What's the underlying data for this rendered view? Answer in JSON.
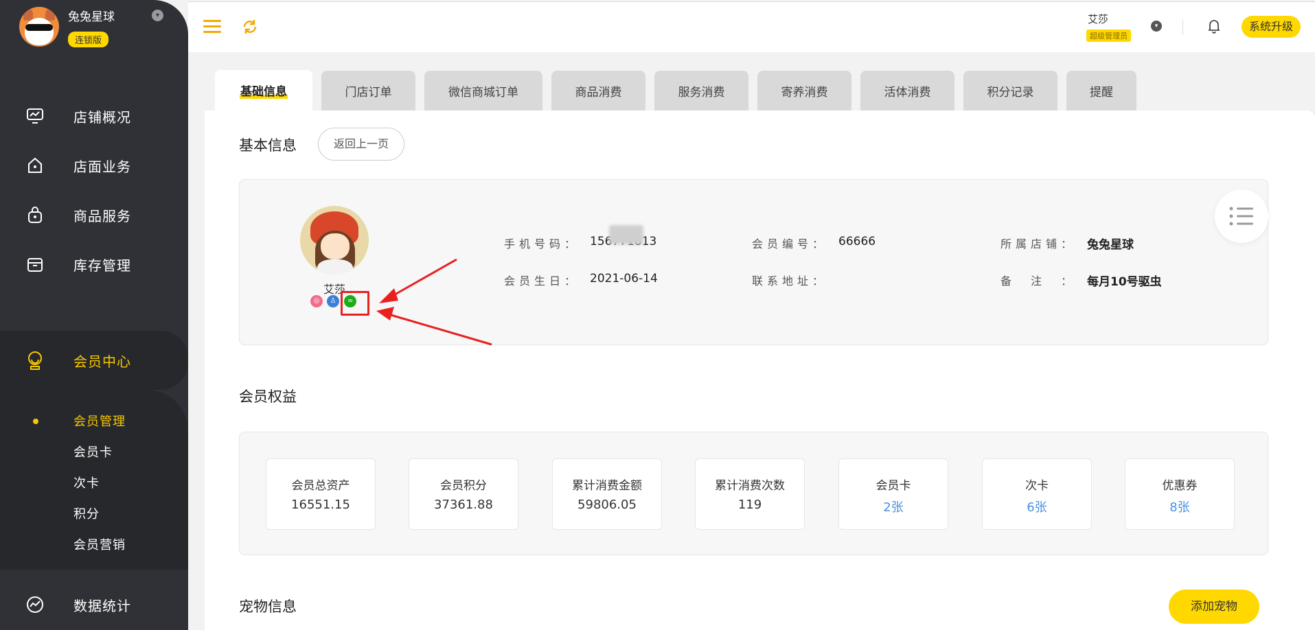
{
  "sidebar": {
    "brand_name": "兔兔星球",
    "brand_badge": "连锁版",
    "items": [
      {
        "label": "店铺概况",
        "icon": "monitor-icon"
      },
      {
        "label": "店面业务",
        "icon": "house-icon"
      },
      {
        "label": "商品服务",
        "icon": "bag-icon"
      },
      {
        "label": "库存管理",
        "icon": "box-icon"
      },
      {
        "label": "会员中心",
        "icon": "member-icon",
        "active": true
      },
      {
        "label": "数据统计",
        "icon": "chart-icon"
      }
    ],
    "sub_items": [
      {
        "label": "会员管理",
        "active": true
      },
      {
        "label": "会员卡"
      },
      {
        "label": "次卡"
      },
      {
        "label": "积分"
      },
      {
        "label": "会员营销"
      }
    ]
  },
  "topbar": {
    "user_name": "艾莎",
    "user_role": "超级管理员",
    "upgrade_label": "系统升级"
  },
  "tabs": [
    {
      "label": "基础信息",
      "active": true
    },
    {
      "label": "门店订单"
    },
    {
      "label": "微信商城订单"
    },
    {
      "label": "商品消费"
    },
    {
      "label": "服务消费"
    },
    {
      "label": "寄养消费"
    },
    {
      "label": "活体消费"
    },
    {
      "label": "积分记录"
    },
    {
      "label": "提醒"
    }
  ],
  "basic_info": {
    "title": "基本信息",
    "back_label": "返回上一页",
    "member_name": "艾莎",
    "fields": {
      "phone_label": "手机号码：",
      "phone_value": "156771813",
      "member_no_label": "会员编号：",
      "member_no_value": "66666",
      "store_label": "所属店铺：",
      "store_value": "兔兔星球",
      "birthday_label": "会员生日：",
      "birthday_value": "2021-06-14",
      "address_label": "联系地址：",
      "address_value": "",
      "remark_label": "备　注　：",
      "remark_value": "每月10号驱虫"
    },
    "badges": [
      {
        "icon": "search-badge-icon",
        "color": "#f26b8a"
      },
      {
        "icon": "person-badge-icon",
        "color": "#3b7fd6"
      },
      {
        "icon": "miniapp-badge-icon",
        "color": "#1aad19"
      }
    ]
  },
  "rights": {
    "title": "会员权益",
    "stats": [
      {
        "label": "会员总资产",
        "value": "16551.15"
      },
      {
        "label": "会员积分",
        "value": "37361.88"
      },
      {
        "label": "累计消费金额",
        "value": "59806.05"
      },
      {
        "label": "累计消费次数",
        "value": "119"
      },
      {
        "label": "会员卡",
        "value": "2张",
        "link": true
      },
      {
        "label": "次卡",
        "value": "6张",
        "link": true
      },
      {
        "label": "优惠券",
        "value": "8张",
        "link": true
      }
    ]
  },
  "pets": {
    "title": "宠物信息",
    "add_label": "添加宠物"
  },
  "colors": {
    "accent": "#ffd800",
    "sidebar_bg": "#2f3136",
    "link": "#4a90e2",
    "annotation": "#e82020"
  }
}
